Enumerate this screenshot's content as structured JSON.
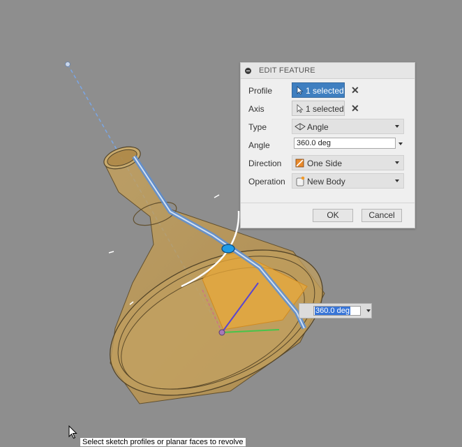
{
  "dialog": {
    "title": "EDIT FEATURE",
    "rows": {
      "profile": {
        "label": "Profile",
        "value": "1 selected"
      },
      "axis": {
        "label": "Axis",
        "value": "1 selected"
      },
      "type": {
        "label": "Type",
        "value": "Angle"
      },
      "angle": {
        "label": "Angle",
        "value": "360.0 deg"
      },
      "direction": {
        "label": "Direction",
        "value": "One Side"
      },
      "operation": {
        "label": "Operation",
        "value": "New Body"
      }
    },
    "ok_label": "OK",
    "cancel_label": "Cancel"
  },
  "canvas": {
    "angle_input_value": "360.0 deg",
    "tooltip": "Select sketch profiles or planar faces to revolve"
  },
  "icons": {
    "collapse": "minus-circle-icon",
    "select": "cursor-arrow-icon",
    "clear": "close-x-icon",
    "type": "angle-icon",
    "direction": "one-side-icon",
    "operation": "new-body-icon"
  },
  "colors": {
    "accent": "#3f7fc0",
    "viewport": "#8e8e8e",
    "body": "#c9a35a",
    "profile_fill": "#e8a83a"
  }
}
